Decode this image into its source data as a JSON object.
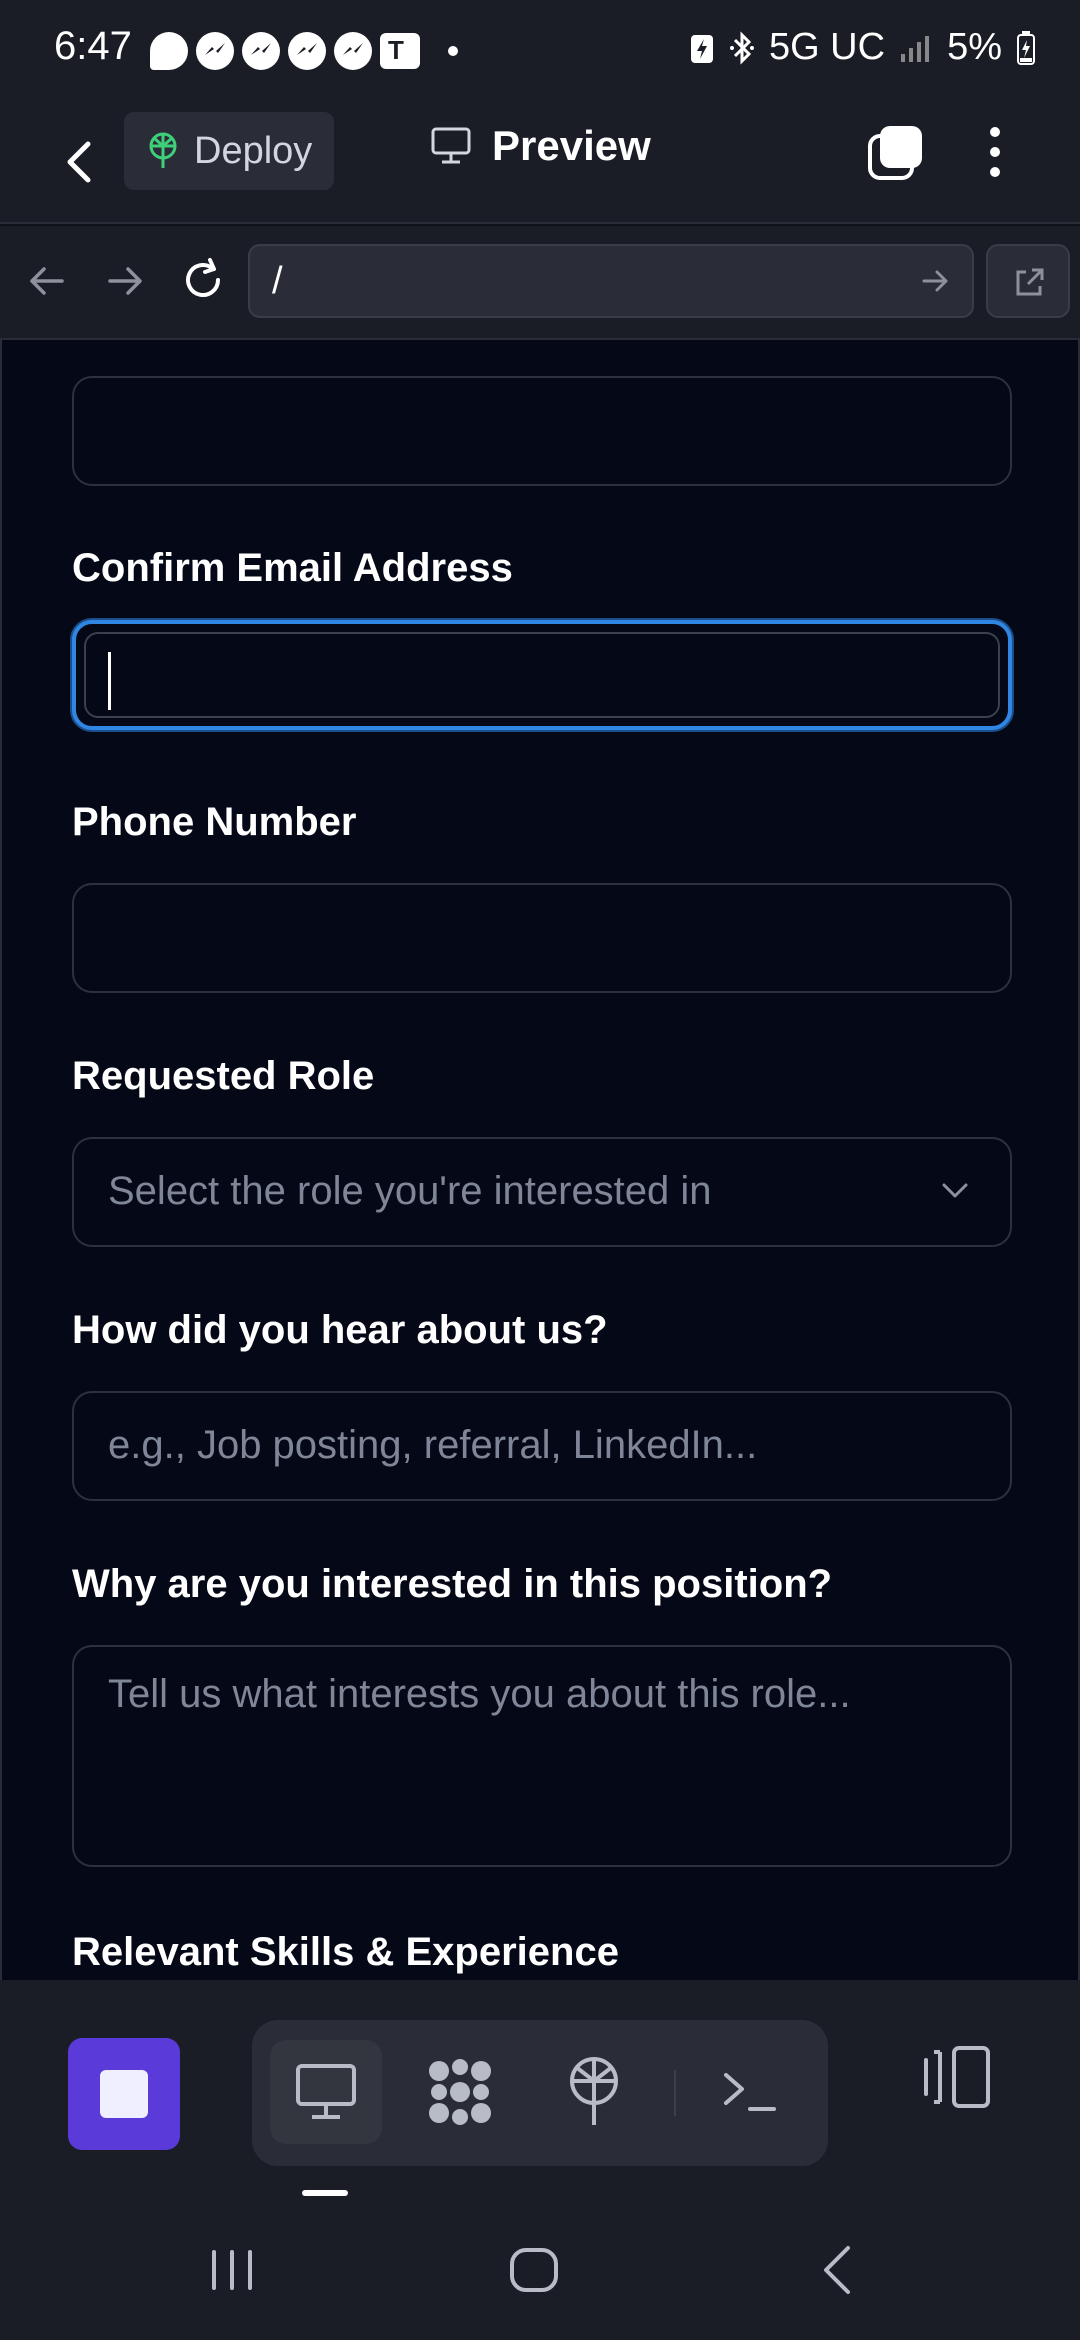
{
  "status_bar": {
    "time": "6:47",
    "network": "5G UC",
    "battery": "5%"
  },
  "header": {
    "deploy_label": "Deploy",
    "preview_label": "Preview"
  },
  "browser": {
    "url": "/"
  },
  "form": {
    "confirm_email": {
      "label": "Confirm Email Address",
      "value": ""
    },
    "phone": {
      "label": "Phone Number",
      "value": ""
    },
    "role": {
      "label": "Requested Role",
      "placeholder": "Select the role you're interested in"
    },
    "source": {
      "label": "How did you hear about us?",
      "placeholder": "e.g., Job posting, referral, LinkedIn..."
    },
    "interest": {
      "label": "Why are you interested in this position?",
      "placeholder": "Tell us what interests you about this role..."
    },
    "skills": {
      "label": "Relevant Skills & Experience"
    }
  },
  "colors": {
    "accent_focus": "#2f87e3",
    "stop_button": "#5a3ad8",
    "deploy_icon": "#3ecf7a"
  },
  "icons": {
    "back": "chevron-left-icon",
    "deploy": "deploy-tree-icon",
    "preview": "monitor-icon",
    "tabs": "tabs-icon",
    "more": "more-vertical-icon",
    "nav_back": "arrow-left-icon",
    "nav_forward": "arrow-right-icon",
    "reload": "reload-icon",
    "url_go": "arrow-right-icon",
    "external": "external-link-icon",
    "stop": "stop-icon",
    "toolbar": [
      "monitor-icon",
      "apps-icon",
      "deploy-icon",
      "terminal-icon"
    ],
    "panel": "panel-icon"
  }
}
